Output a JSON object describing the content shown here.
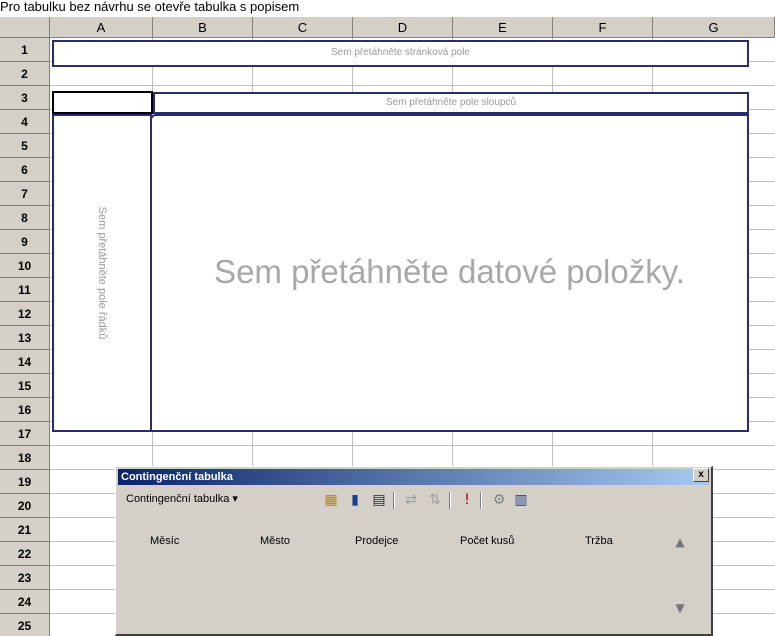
{
  "caption": "Pro tabulku bez návrhu se otevře tabulka s popisem",
  "columns": [
    "A",
    "B",
    "C",
    "D",
    "E",
    "F",
    "G"
  ],
  "rows": [
    "1",
    "2",
    "3",
    "4",
    "5",
    "6",
    "7",
    "8",
    "9",
    "10",
    "11",
    "12",
    "13",
    "14",
    "15",
    "16",
    "17",
    "18",
    "19",
    "20",
    "21",
    "22",
    "23",
    "24",
    "25"
  ],
  "pivot": {
    "page_drop": "Sem přetáhněte stránková pole",
    "column_drop": "Sem přetáhněte pole sloupců",
    "row_drop": "Sem přetáhněte pole řádků",
    "data_drop": "Sem přetáhněte datové položky."
  },
  "toolbar": {
    "title": "Contingenční tabulka",
    "close": "x",
    "menu_label": "Contingenční tabulka ▾",
    "fields": [
      "Měsíc",
      "Město",
      "Prodejce",
      "Počet kusů",
      "Tržba"
    ]
  },
  "colors": {
    "zone_border": "#2b2b6f",
    "title_start": "#0a246a",
    "title_end": "#a6caf0"
  }
}
